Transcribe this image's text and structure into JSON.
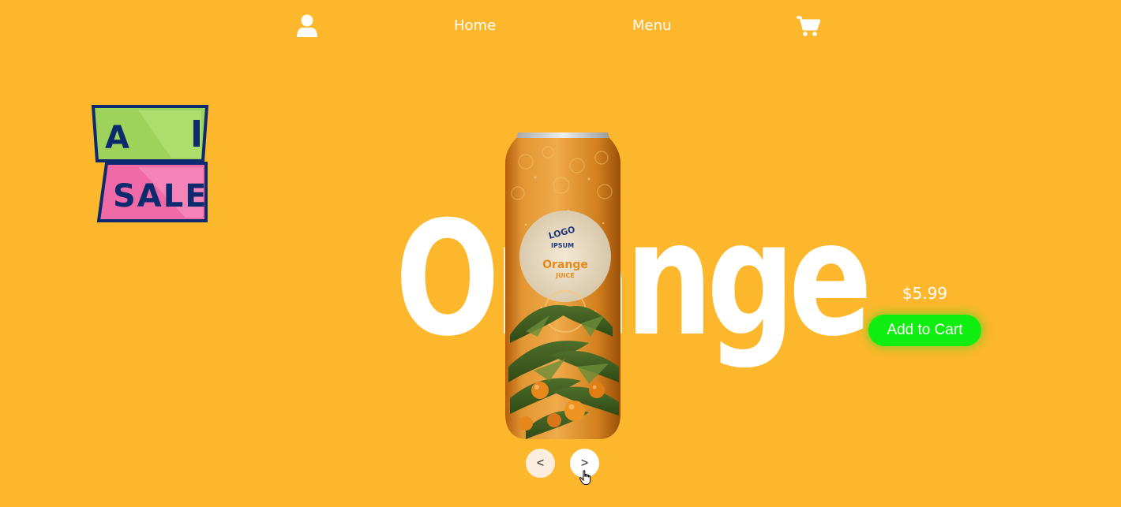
{
  "nav": {
    "user_icon": "user-icon",
    "home_label": "Home",
    "menu_label": "Menu",
    "cart_icon": "shopping-cart-icon"
  },
  "badge": {
    "icon": "sale-tag-icon",
    "text": "SALE",
    "colors": {
      "top": "#9ed25a",
      "bottom": "#f06aa8",
      "outline": "#0d2a6e"
    }
  },
  "product": {
    "name": "Orange",
    "can": {
      "logo_line1": "LOGO",
      "logo_line2": "IPSUM",
      "flavor": "Orange",
      "type": "JUICE"
    },
    "price": "$5.99",
    "add_to_cart_label": "Add to Cart"
  },
  "carousel": {
    "prev_label": "<",
    "next_label": ">"
  },
  "colors": {
    "background": "#FDB72C",
    "button_green": "#10ee10",
    "text": "#ffffff"
  }
}
